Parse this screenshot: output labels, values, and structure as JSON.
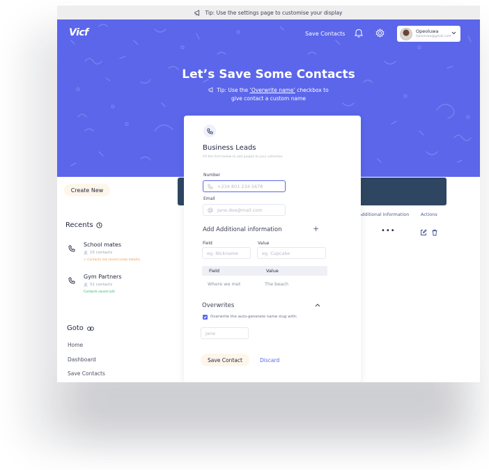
{
  "tipbar": {
    "text": "Tip: Use the settings page to customise your display"
  },
  "header": {
    "logo": "Vicf",
    "nav_save": "Save Contacts",
    "profile_name": "Opeoluwa",
    "profile_role": "Opeoluwa@gmail.com"
  },
  "hero": {
    "title": "Let’s Save Some Contacts",
    "tip_prefix": "Tip: Use the ",
    "tip_link": "‘Overwrite name’",
    "tip_suffix": " checkbox to",
    "tip_line2": "give contact a custom name"
  },
  "sidebar": {
    "create_new": "Create New",
    "recents_title": "Recents",
    "recents": [
      {
        "name": "School mates",
        "count": "15 contacts",
        "note": "+ Contacts not saved (undo details)",
        "note_color": "#f2994a"
      },
      {
        "name": "Gym Partners",
        "count": "52 contacts",
        "note": "Contacts saved (all)",
        "note_color": "#27ae60"
      }
    ],
    "goto_title": "Goto",
    "goto_links": [
      "Home",
      "Dashboard",
      "Save Contacts"
    ]
  },
  "table": {
    "col_additional": "Additional Information",
    "col_actions": "Actions",
    "more": "•••"
  },
  "form": {
    "title": "Business Leads",
    "subtitle": "Fill the form below to add people to your collection",
    "number_label": "Number",
    "number_placeholder": "+234 801 234 5678",
    "email_label": "Email",
    "email_placeholder": "Jane.doe@mail.com",
    "add_info": "Add Additional information",
    "add_plus": "+",
    "field_label": "Field",
    "field_placeholder": "eg. Nickname",
    "value_label": "Value",
    "value_placeholder": "eg. Cupcake",
    "kv_head_field": "Field",
    "kv_head_value": "Value",
    "kv_row_field": "Where we met",
    "kv_row_value": "The beach",
    "overwrites": "Overwrites",
    "checkbox_label": "Overwrite the auto-generate name slug with:",
    "checkbox_checked": true,
    "slug_placeholder": "Jane",
    "save_button": "Save Contact",
    "discard": "Discard"
  },
  "colors": {
    "brand": "#5b66ea",
    "table_header": "#2e4661",
    "button_bg": "#fdf6ea"
  },
  "icons": [
    "megaphone-icon",
    "bell-icon",
    "gear-icon",
    "chevron-down-icon",
    "phone-icon",
    "mail-icon",
    "clock-icon",
    "user-icon",
    "link-icon",
    "edit-icon",
    "trash-icon",
    "chevron-up-icon",
    "check-icon"
  ]
}
